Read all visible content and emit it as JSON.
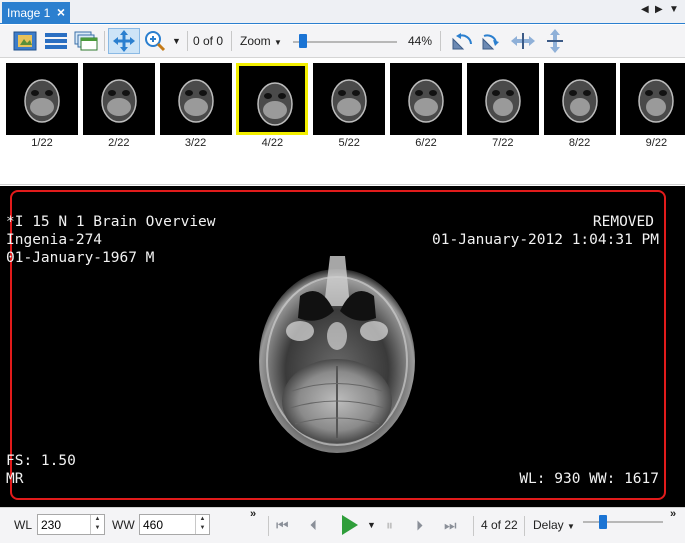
{
  "tabs": [
    {
      "label": "Image 1"
    }
  ],
  "toolbar": {
    "frame_counter": "0 of 0",
    "zoom_label": "Zoom",
    "zoom_value": "44%",
    "zoom_slider_fraction": 0.1
  },
  "thumbnails": [
    {
      "label": "1/22"
    },
    {
      "label": "2/22"
    },
    {
      "label": "3/22"
    },
    {
      "label": "4/22",
      "selected": true
    },
    {
      "label": "5/22"
    },
    {
      "label": "6/22"
    },
    {
      "label": "7/22"
    },
    {
      "label": "8/22"
    },
    {
      "label": "9/22"
    }
  ],
  "viewer": {
    "top_left": [
      "*I 15 N 1 Brain Overview",
      "Ingenia-274",
      "01-January-1967 M"
    ],
    "top_right": [
      "REMOVED",
      "01-January-2012 1:04:31 PM"
    ],
    "bottom_left": [
      "FS: 1.50",
      "MR"
    ],
    "bottom_right": "WL: 930 WW: 1617"
  },
  "bottom": {
    "wl_label": "WL",
    "wl_value": "230",
    "ww_label": "WW",
    "ww_value": "460",
    "frame_counter": "4 of 22",
    "delay_label": "Delay",
    "delay_slider_fraction": 0.25
  },
  "colors": {
    "accent": "#2b7fcf",
    "selection": "#f2ee00",
    "viewer_frame": "#e21b1b",
    "play": "#2f9e3a"
  }
}
